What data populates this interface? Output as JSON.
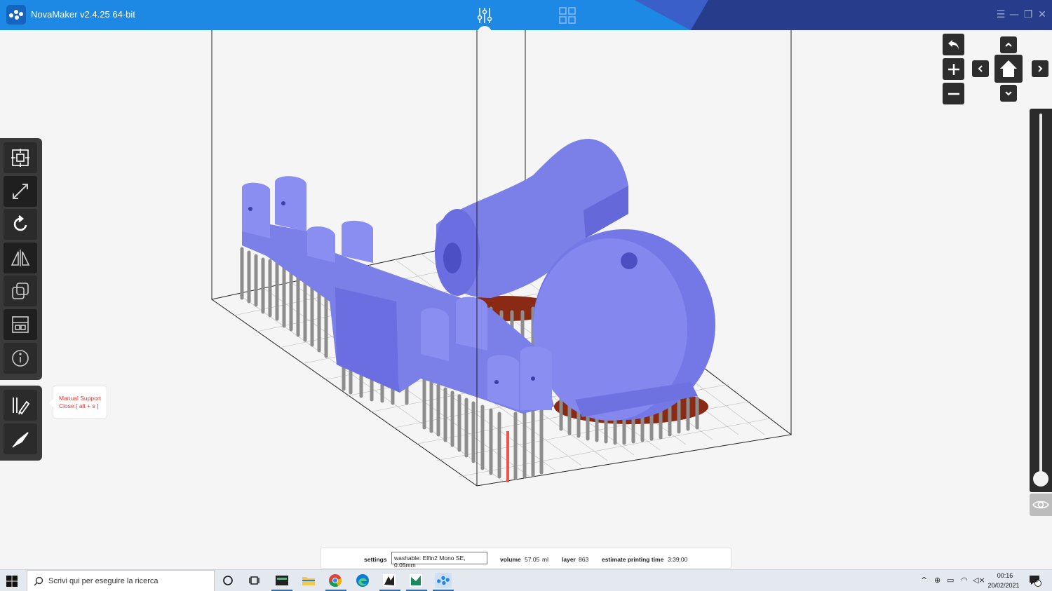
{
  "app": {
    "title": "NovaMaker v2.4.25 64-bit"
  },
  "window_controls": {
    "menu_icon": "hamburger-icon",
    "minimize_icon": "minimize-icon",
    "restore_icon": "restore-icon",
    "close_icon": "close-icon"
  },
  "tooltip": {
    "line1": "Manual Support",
    "line2": "Close:[ alt + s ]"
  },
  "toolbar": {
    "tools": [
      "auto-layout-icon",
      "scale-icon",
      "rotate-icon",
      "mirror-icon",
      "duplicate-icon",
      "arrange-icon",
      "info-icon"
    ],
    "support_tools": [
      "manual-support-icon",
      "support-edit-icon"
    ]
  },
  "status": {
    "settings_label": "settings",
    "settings_value": "washable: Elfin2 Mono SE, 0.05mm",
    "volume_label": "volume",
    "volume_value": "57.05",
    "volume_unit": "ml",
    "layer_label": "layer",
    "layer_value": "863",
    "time_label": "estimate printing time",
    "time_value": "3:39:00"
  },
  "taskbar": {
    "search_placeholder": "Scrivi qui per eseguire la ricerca",
    "time": "00:16",
    "date": "20/02/2021",
    "notifications": "4"
  },
  "colors": {
    "titlebar": "#1e88e5",
    "titlebar_dark": "#283c8c",
    "model": "#7b7fe8",
    "support": "#9a9a9a",
    "accent_red": "#e53935"
  }
}
